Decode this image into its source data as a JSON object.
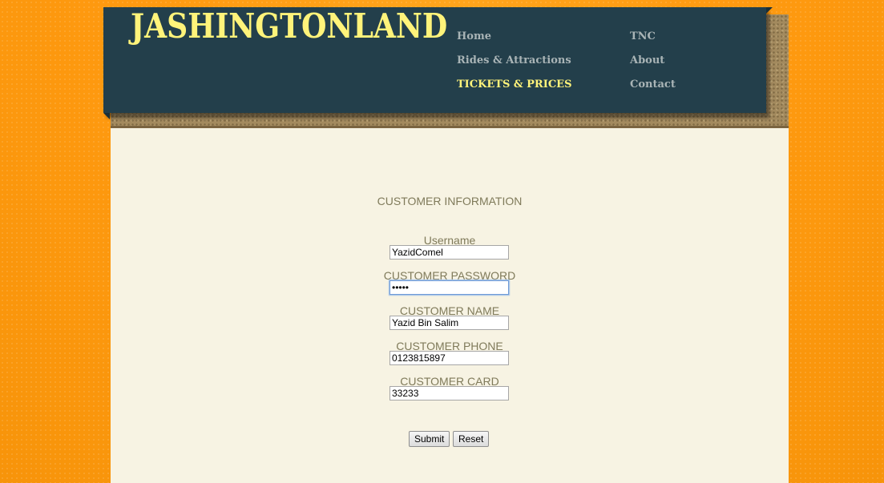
{
  "site": {
    "logo": "JASHINGTONLAND"
  },
  "nav": {
    "home": "Home",
    "rides": "Rides & Attractions",
    "tickets": "TICKETS & PRICES",
    "tnc": "TNC",
    "about": "About",
    "contact": "Contact",
    "active_item": "TICKETS & PRICES"
  },
  "form": {
    "title": "CUSTOMER INFORMATION",
    "username": {
      "label": "Username",
      "value": "YazidComel"
    },
    "password": {
      "label": "CUSTOMER PASSWORD",
      "value": "•••••"
    },
    "name": {
      "label": "CUSTOMER NAME",
      "value": "Yazid Bin Salim"
    },
    "phone": {
      "label": "CUSTOMER PHONE",
      "value": "0123815897"
    },
    "card": {
      "label": "CUSTOMER CARD",
      "value": "33233"
    },
    "submit_label": "Submit",
    "reset_label": "Reset"
  },
  "colors": {
    "header_bg": "#233f4b",
    "logo": "#fff37a",
    "nav_text": "#a9b4b6",
    "nav_active": "#fff37a",
    "content_bg": "#f7f3e3",
    "label_text": "#7f7a5a",
    "page_bg": "#ff9a10"
  }
}
